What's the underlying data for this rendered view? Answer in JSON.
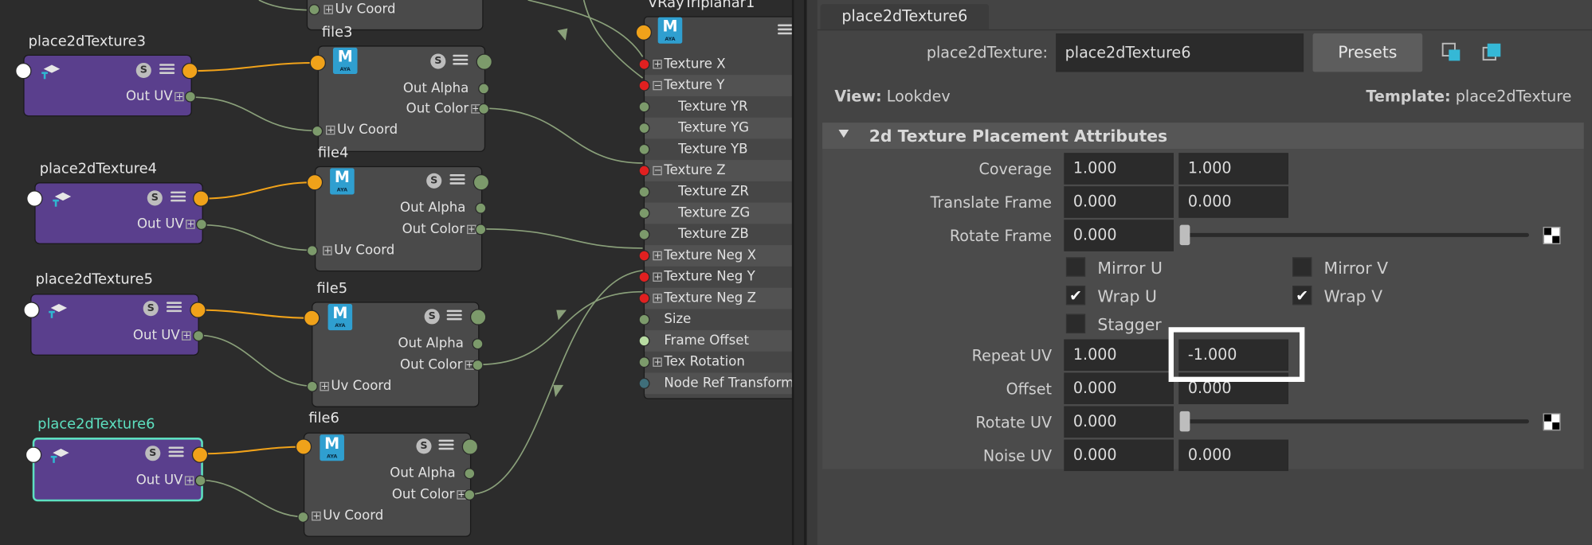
{
  "node_editor": {
    "place_nodes": [
      {
        "title": "place2dTexture3",
        "out_uv": "Out UV",
        "selected": false
      },
      {
        "title": "place2dTexture4",
        "out_uv": "Out UV",
        "selected": false
      },
      {
        "title": "place2dTexture5",
        "out_uv": "Out UV",
        "selected": false
      },
      {
        "title": "place2dTexture6",
        "out_uv": "Out UV",
        "selected": true
      }
    ],
    "file_nodes": [
      {
        "title": "file3",
        "out_alpha": "Out Alpha",
        "out_color": "Out Color",
        "uv_coord": "Uv Coord"
      },
      {
        "title": "file4",
        "out_alpha": "Out Alpha",
        "out_color": "Out Color",
        "uv_coord": "Uv Coord"
      },
      {
        "title": "file5",
        "out_alpha": "Out Alpha",
        "out_color": "Out Color",
        "uv_coord": "Uv Coord"
      },
      {
        "title": "file6",
        "out_alpha": "Out Alpha",
        "out_color": "Out Color",
        "uv_coord": "Uv Coord"
      }
    ],
    "top_partial_uv_coord": "Uv Coord",
    "triplanar": {
      "title": "VRayTriplanar1",
      "ports": [
        {
          "label": "Texture X",
          "expand": true
        },
        {
          "label": "Texture Y",
          "expand": true
        },
        {
          "label": "Texture YR",
          "expand": false
        },
        {
          "label": "Texture YG",
          "expand": false
        },
        {
          "label": "Texture YB",
          "expand": false
        },
        {
          "label": "Texture Z",
          "expand": true
        },
        {
          "label": "Texture ZR",
          "expand": false
        },
        {
          "label": "Texture ZG",
          "expand": false
        },
        {
          "label": "Texture ZB",
          "expand": false
        },
        {
          "label": "Texture Neg X",
          "expand": true
        },
        {
          "label": "Texture Neg Y",
          "expand": true
        },
        {
          "label": "Texture Neg Z",
          "expand": true
        },
        {
          "label": "Size",
          "expand": false
        },
        {
          "label": "Frame Offset",
          "expand": false
        },
        {
          "label": "Tex Rotation",
          "expand": true
        },
        {
          "label": "Node Ref Transform",
          "expand": false
        }
      ]
    },
    "icon_texts": {
      "s": "S",
      "m": "M",
      "maya": "AYA"
    }
  },
  "attribute_editor": {
    "tab_label": "place2dTexture6",
    "node_type_label": "place2dTexture:",
    "node_name": "place2dTexture6",
    "presets_label": "Presets",
    "view_label": "View:",
    "view_value": "Lookdev",
    "template_label": "Template:",
    "template_value": "place2dTexture",
    "section_title": "2d Texture Placement Attributes",
    "coverage": {
      "label": "Coverage",
      "u": "1.000",
      "v": "1.000"
    },
    "translate_frame": {
      "label": "Translate Frame",
      "u": "0.000",
      "v": "0.000"
    },
    "rotate_frame": {
      "label": "Rotate Frame",
      "value": "0.000"
    },
    "checkboxes": {
      "mirror_u": {
        "label": "Mirror U",
        "checked": false
      },
      "mirror_v": {
        "label": "Mirror V",
        "checked": false
      },
      "wrap_u": {
        "label": "Wrap U",
        "checked": true
      },
      "wrap_v": {
        "label": "Wrap V",
        "checked": true
      },
      "stagger": {
        "label": "Stagger",
        "checked": false
      }
    },
    "repeat_uv": {
      "label": "Repeat UV",
      "u": "1.000",
      "v": "-1.000"
    },
    "offset": {
      "label": "Offset",
      "u": "0.000",
      "v": "0.000"
    },
    "rotate_uv": {
      "label": "Rotate UV",
      "value": "0.000"
    },
    "noise_uv": {
      "label": "Noise UV",
      "u": "0.000",
      "v": "0.000"
    },
    "check_glyph": "✔"
  },
  "colors": {
    "place_node": "#5a3f8d",
    "selected_outline": "#5de0c0",
    "orange_port": "#f0a21a",
    "green_port": "#7c9a6b",
    "red_port": "#e02020",
    "wire_orange": "#f0a21a",
    "wire_green": "#8aa07a"
  }
}
